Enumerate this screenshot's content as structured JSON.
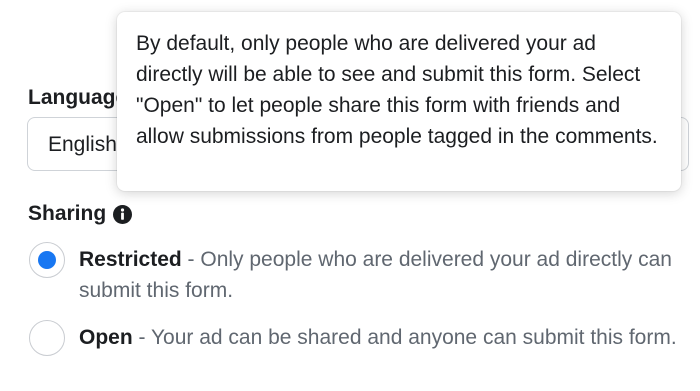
{
  "language": {
    "label": "Language",
    "selected_value": "English"
  },
  "tooltip": {
    "text": "By default, only people who are delivered your ad directly will be able to see and submit this form. Select \"Open\" to let people share this form with friends and allow submissions from people tagged in the comments."
  },
  "sharing": {
    "label": "Sharing",
    "options": [
      {
        "title": "Restricted",
        "description": " - Only people who are delivered your ad directly can submit this form.",
        "selected": true
      },
      {
        "title": "Open",
        "description": " - Your ad can be shared and anyone can submit this form.",
        "selected": false
      }
    ]
  },
  "colors": {
    "accent": "#1877f2",
    "text_primary": "#1c1e21",
    "text_secondary": "#606770",
    "border": "#cfd3d8"
  },
  "icons": {
    "sharing_info": "info-icon"
  }
}
